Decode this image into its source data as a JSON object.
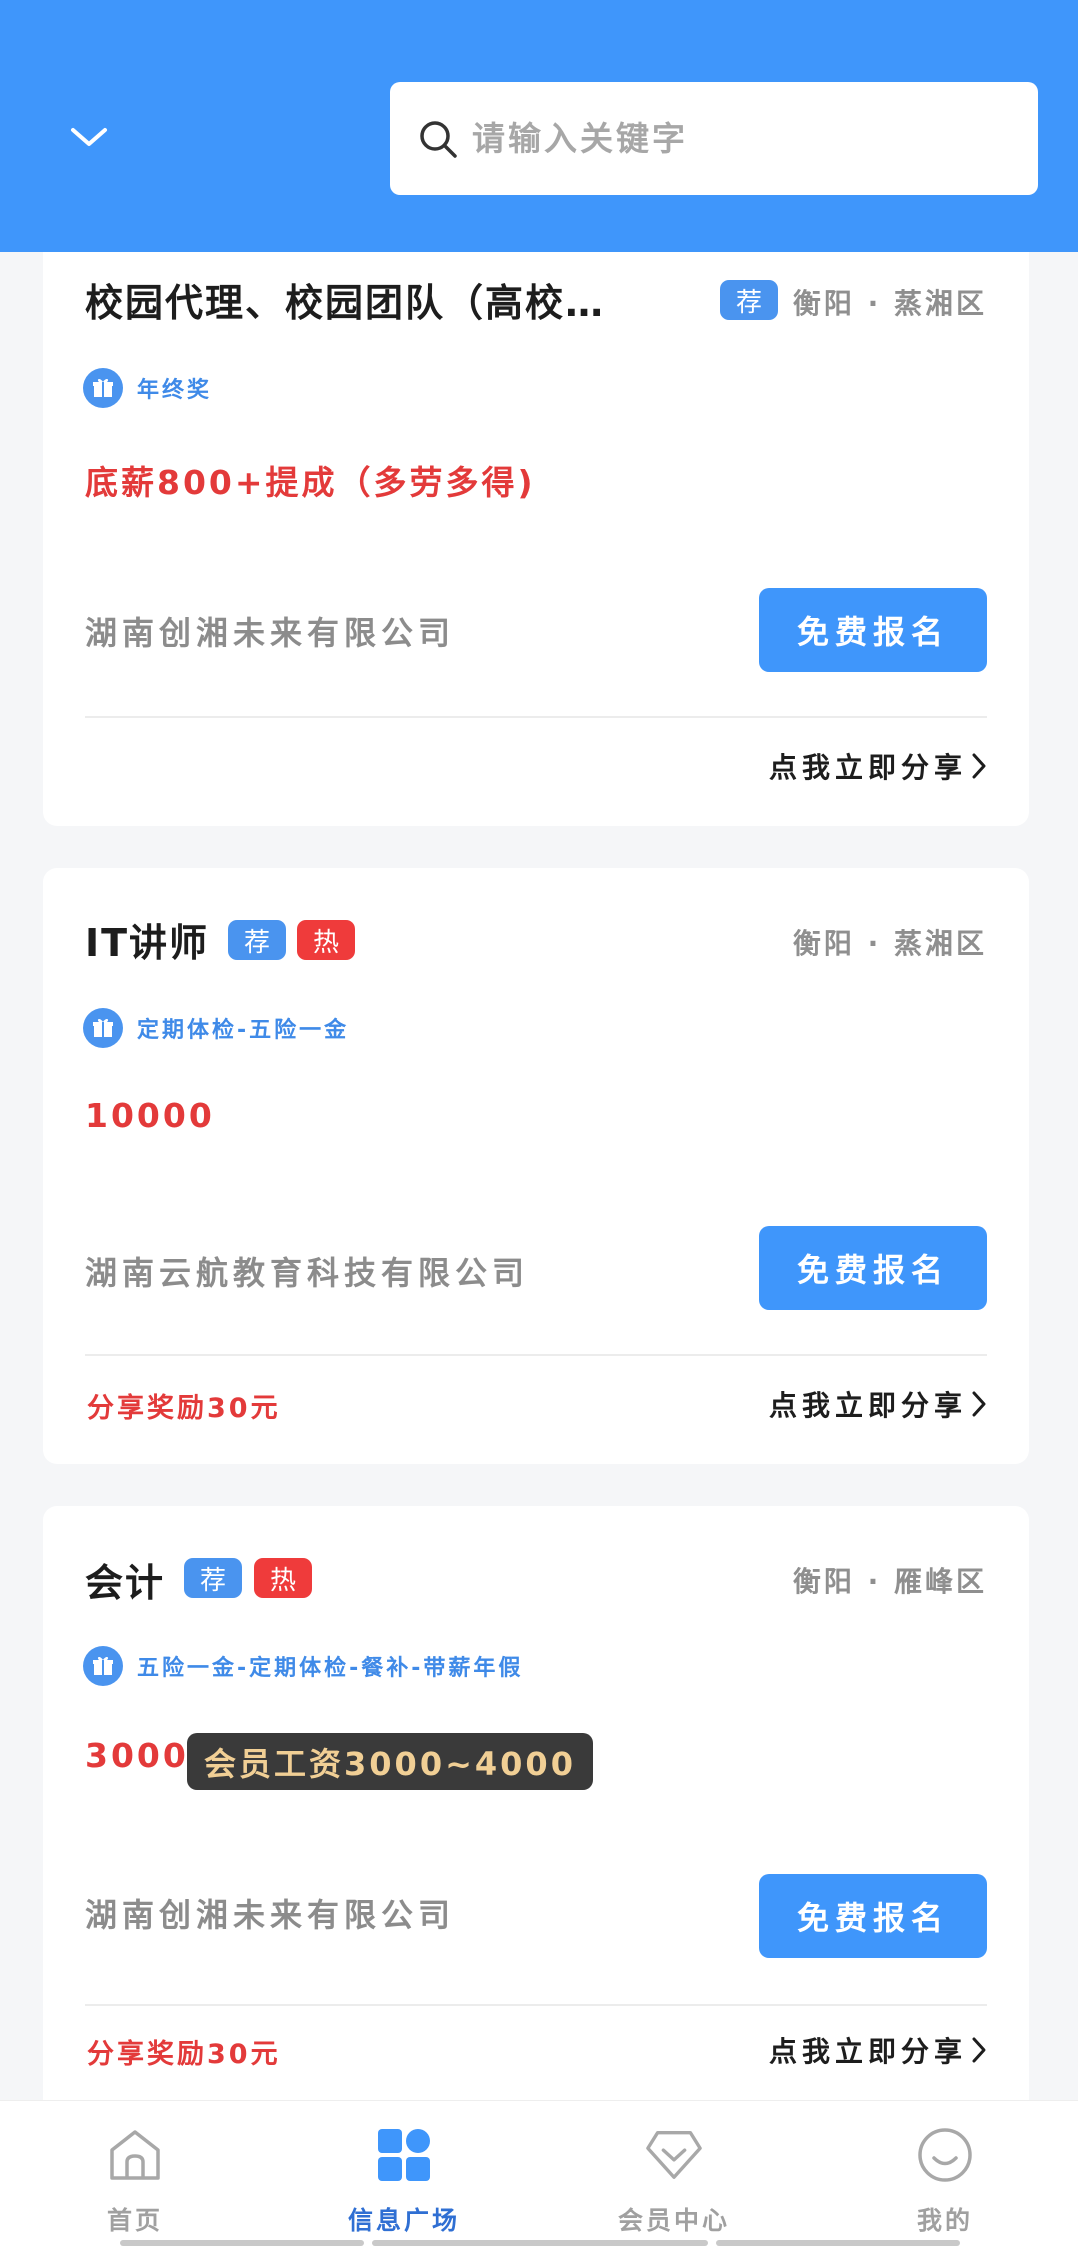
{
  "header": {
    "search_placeholder": "请输入关键字"
  },
  "jobs": [
    {
      "title": "校园代理、校园团队（高校…",
      "tags": [
        "荐"
      ],
      "location": "衡阳 · 蒸湘区",
      "benefits": "年终奖",
      "salary": "底薪800+提成（多劳多得)",
      "company": "湖南创湘未来有限公司",
      "signup_label": "免费报名",
      "share_label": "点我立即分享"
    },
    {
      "title": "IT讲师",
      "tags": [
        "荐",
        "热"
      ],
      "location": "衡阳 · 蒸湘区",
      "benefits": "定期体检-五险一金",
      "salary": "10000",
      "company": "湖南云航教育科技有限公司",
      "signup_label": "免费报名",
      "reward": "分享奖励30元",
      "share_label": "点我立即分享"
    },
    {
      "title": "会计",
      "tags": [
        "荐",
        "热"
      ],
      "location": "衡阳 · 雁峰区",
      "benefits": "五险一金-定期体检-餐补-带薪年假",
      "salary": "3000",
      "member_salary": "会员工资3000~4000",
      "company": "湖南创湘未来有限公司",
      "signup_label": "免费报名",
      "reward": "分享奖励30元",
      "share_label": "点我立即分享"
    }
  ],
  "nav": {
    "items": [
      {
        "label": "首页",
        "icon": "home-icon"
      },
      {
        "label": "信息广场",
        "icon": "grid-icon",
        "active": true
      },
      {
        "label": "会员中心",
        "icon": "diamond-icon"
      },
      {
        "label": "我的",
        "icon": "smiley-icon"
      }
    ]
  },
  "colors": {
    "primary": "#3f96fb",
    "accent_red": "#e33a3a",
    "nav_active": "#2f6fd3"
  }
}
